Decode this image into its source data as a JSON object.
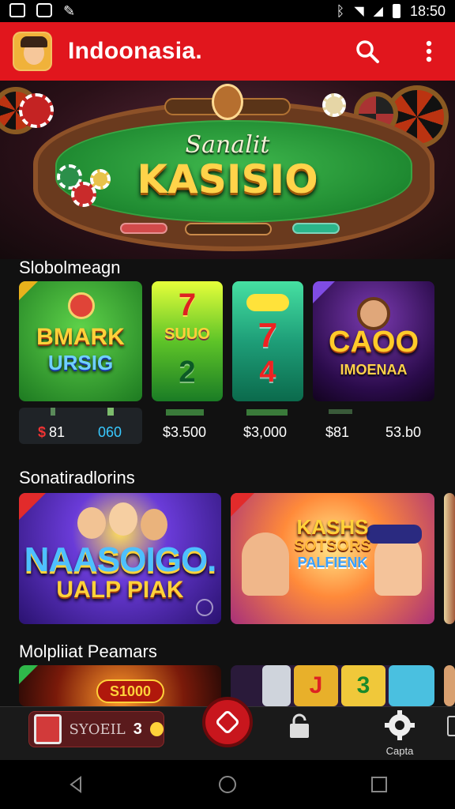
{
  "status_bar": {
    "time": "18:50",
    "icons": [
      "image-icon",
      "p-icon",
      "wrench-icon",
      "bluetooth-icon",
      "wifi-icon",
      "battery-icon"
    ]
  },
  "app_bar": {
    "title": "Indoonasia.",
    "avatar_icon": "avatar-icon",
    "search_icon": "search-icon",
    "menu_icon": "more-vert-icon",
    "color": "#e1161d"
  },
  "hero": {
    "subtitle": "Sanalit",
    "title": "KASISIO"
  },
  "section1": {
    "title": "Slobolmeagn",
    "cards": [
      {
        "name": "bmark",
        "title_line1": "BMARK",
        "title_line2": "URSIG"
      },
      {
        "name": "slot-green",
        "symbols": [
          "7",
          "SUUO",
          "2"
        ]
      },
      {
        "name": "slot-teal",
        "symbols": [
          "7",
          "4"
        ]
      },
      {
        "name": "caoo",
        "title_line1": "CAOO",
        "title_line2": "IMOENAA"
      }
    ],
    "prices": [
      "81",
      "060",
      "$3.500",
      "$3,000",
      "$81",
      "53.b0"
    ]
  },
  "section2": {
    "title": "Sonatiradlorins",
    "cards": [
      {
        "name": "naasoigo",
        "title_line1": "NAASOIGO.",
        "title_line2": "UALP PIAK"
      },
      {
        "name": "kashs",
        "title_line1": "KASHS",
        "title_line2": "SOTSORS",
        "title_line3": "PALFIENK"
      }
    ]
  },
  "section3": {
    "title": "Molpliiat Peamars",
    "cards": [
      {
        "name": "s1000",
        "badge": "S1000"
      },
      {
        "name": "slots-j3",
        "symbols": [
          "J",
          "3"
        ]
      }
    ]
  },
  "bottom_bar": {
    "items": [
      {
        "icon": "gift-box-icon",
        "label": "SYOEIL",
        "count": "3"
      },
      {
        "icon": "center-spin-icon"
      },
      {
        "icon": "lock-icon"
      },
      {
        "icon": "gear-icon",
        "label": "Capta"
      }
    ]
  },
  "nav_bar": {
    "back_icon": "back-icon",
    "home_icon": "home-icon",
    "recents_icon": "recents-icon"
  }
}
